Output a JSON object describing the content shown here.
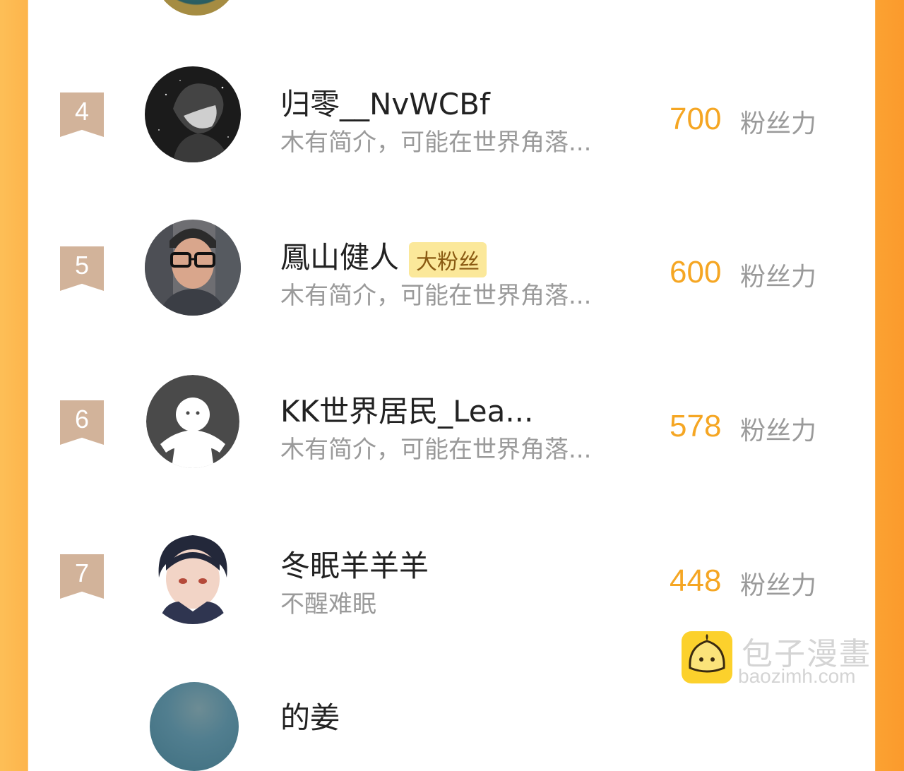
{
  "ranking": {
    "items": [
      {
        "rank": "4",
        "name": "归零__NvWCBf",
        "badge": "",
        "bio": "木有简介，可能在世界角落...",
        "score": "700",
        "unit": "粉丝力",
        "avatar": "grayscale-anime-avatar"
      },
      {
        "rank": "5",
        "name": "鳳山健人",
        "badge": "大粉丝",
        "bio": "木有简介，可能在世界角落...",
        "score": "600",
        "unit": "粉丝力",
        "avatar": "photo-avatar"
      },
      {
        "rank": "6",
        "name": "KK世界居民_Lea...",
        "badge": "",
        "bio": "木有简介，可能在世界角落...",
        "score": "578",
        "unit": "粉丝力",
        "avatar": "default-user-avatar"
      },
      {
        "rank": "7",
        "name": "冬眠羊羊羊",
        "badge": "",
        "bio": "不醒难眠",
        "score": "448",
        "unit": "粉丝力",
        "avatar": "anime-boy-avatar"
      }
    ],
    "next_item_name": "的姜"
  },
  "colors": {
    "accent": "#f5a623",
    "rank_badge": "#d2b39a",
    "frame_left": "#fdb44b",
    "frame_right": "#fb9a2c",
    "fan_badge_bg": "#fbe89a"
  },
  "watermark": {
    "title": "包子漫畫",
    "url": "baozimh.com"
  }
}
